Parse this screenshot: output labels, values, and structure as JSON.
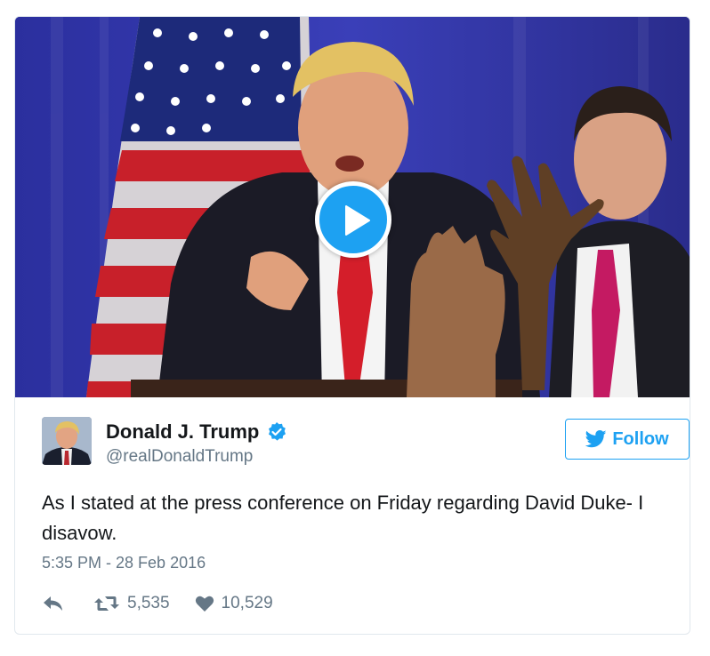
{
  "tweet": {
    "author_name": "Donald J. Trump",
    "author_handle": "@realDonaldTrump",
    "follow_label": "Follow",
    "text": "As I stated at the press conference on Friday regarding David Duke- I disavow.",
    "timestamp": "5:35 PM - 28 Feb 2016",
    "retweet_count": "5,535",
    "like_count": "10,529"
  },
  "icons": {
    "verified": "verified-badge-icon",
    "play": "play-icon",
    "follow": "twitter-bird-icon",
    "reply": "reply-icon",
    "retweet": "retweet-icon",
    "like": "heart-icon"
  },
  "colors": {
    "accent": "#1da1f2",
    "text": "#14171a",
    "muted": "#657786",
    "border": "#e1e8ed"
  }
}
